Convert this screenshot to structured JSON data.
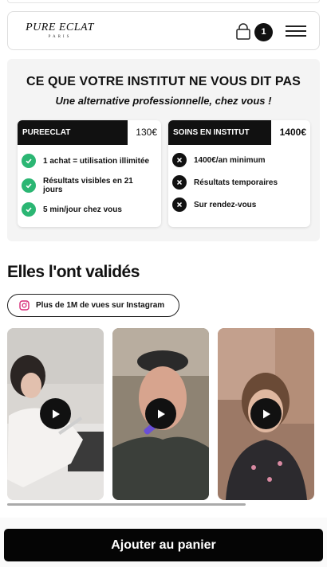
{
  "header": {
    "logo_main": "PURE ECLAT",
    "logo_sub": "PARIS",
    "cart_count": "1",
    "icons": [
      "shopping-bag-icon",
      "hamburger-menu-icon"
    ]
  },
  "comparison": {
    "title": "CE QUE VOTRE INSTITUT NE VOUS DIT PAS",
    "subtitle": "Une alternative professionnelle, chez vous !",
    "left": {
      "name": "PUREECLAT",
      "price": "130€",
      "features": [
        "1 achat = utilisation illimitée",
        "Résultats visibles en 21 jours",
        "5 min/jour chez vous"
      ]
    },
    "right": {
      "name": "SOINS EN INSTITUT",
      "price": "1400€",
      "features": [
        "1400€/an minimum",
        "Résultats temporaires",
        "Sur rendez-vous"
      ]
    },
    "colors": {
      "check": "#2bb673",
      "cross": "#111111"
    }
  },
  "reviews": {
    "title": "Elles l'ont validés",
    "instagram_label": "Plus de 1M de vues sur Instagram",
    "instagram_color": "#d62976",
    "videos": [
      "video-1",
      "video-2",
      "video-3"
    ]
  },
  "cta": {
    "label": "Ajouter au panier"
  }
}
